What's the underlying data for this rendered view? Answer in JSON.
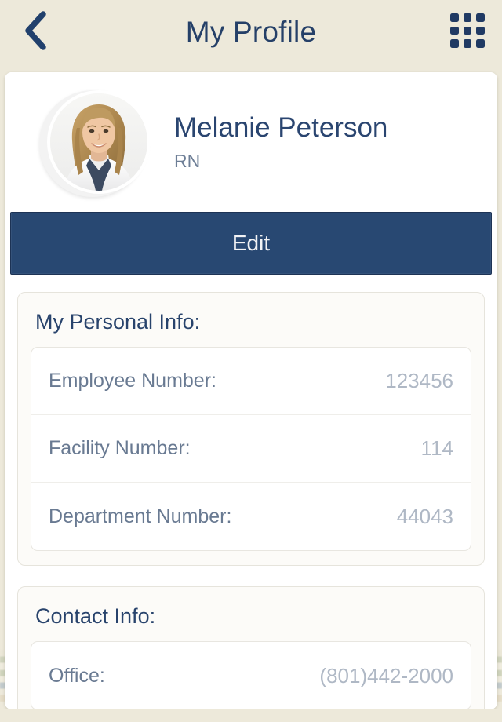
{
  "theme": {
    "background": "#EDE9DA",
    "card_background": "#FFFFFF",
    "navy": "#284872",
    "title_navy": "#254068",
    "label_slate": "#697A92",
    "value_gray": "#AFB8C5",
    "section_background": "#FCFBF8"
  },
  "header": {
    "title": "My Profile",
    "back_icon": "chevron-left-icon",
    "menu_icon": "grid-apps-icon"
  },
  "profile": {
    "avatar_alt": "profile-photo",
    "name": "Melanie Peterson",
    "role": "RN"
  },
  "actions": {
    "edit_label": "Edit"
  },
  "sections": [
    {
      "id": "personal-info",
      "title": "My Personal Info:",
      "rows": [
        {
          "label": "Employee Number:",
          "value": "123456"
        },
        {
          "label": "Facility Number:",
          "value": "114"
        },
        {
          "label": "Department Number:",
          "value": "44043"
        }
      ]
    },
    {
      "id": "contact-info",
      "title": "Contact Info:",
      "rows": [
        {
          "label": "Office:",
          "value": "(801)442-2000"
        }
      ]
    }
  ]
}
